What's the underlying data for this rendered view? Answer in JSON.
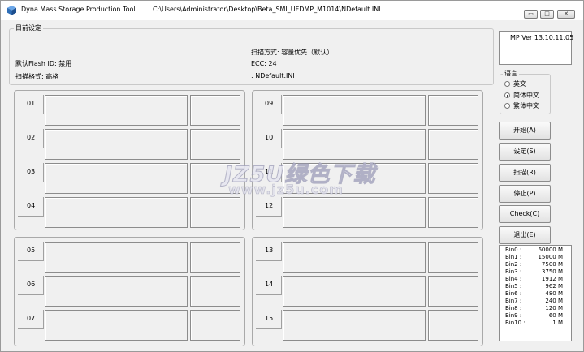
{
  "window": {
    "title": "Dyna Mass Storage Production Tool",
    "path": "C:\\Users\\Administrator\\Desktop\\Beta_SMI_UFDMP_M1014\\NDefault.INI",
    "min_glyph": "▭",
    "max_glyph": "□",
    "close_glyph": "✕"
  },
  "settings": {
    "legend": "目前设定",
    "scan_mode": "扫描方式: 容量优先（默认）",
    "flash_id": "默认Flash ID: 禁用",
    "ecc": "ECC: 24",
    "scan_format": "扫描格式: 高格",
    "ini_file": ": NDefault.INI"
  },
  "version": "MP Ver 13.10.11.05",
  "language": {
    "legend": "语言",
    "options": [
      "英文",
      "简体中文",
      "繁体中文"
    ],
    "selected": "简体中文"
  },
  "buttons": {
    "start": "开始(A)",
    "settings": "设定(S)",
    "scan": "扫描(R)",
    "stop": "停止(P)",
    "check": "Check(C)",
    "exit": "退出(E)"
  },
  "slots": [
    "01",
    "02",
    "03",
    "04",
    "05",
    "06",
    "07",
    "09",
    "10",
    "11",
    "12",
    "13",
    "14",
    "15"
  ],
  "bins": [
    {
      "name": "Bin0 :",
      "value": "60000 M"
    },
    {
      "name": "Bin1 :",
      "value": "15000 M"
    },
    {
      "name": "Bin2 :",
      "value": "7500 M"
    },
    {
      "name": "Bin3 :",
      "value": "3750 M"
    },
    {
      "name": "Bin4 :",
      "value": "1912 M"
    },
    {
      "name": "Bin5 :",
      "value": "962 M"
    },
    {
      "name": "Bin6 :",
      "value": "480 M"
    },
    {
      "name": "Bin7 :",
      "value": "240 M"
    },
    {
      "name": "Bin8 :",
      "value": "120 M"
    },
    {
      "name": "Bin9 :",
      "value": "60 M"
    },
    {
      "name": "Bin10 :",
      "value": "1 M"
    }
  ],
  "watermark": {
    "line1": "JZ5U绿色下载",
    "line2": "www.jz5u.com"
  },
  "colors": {
    "window_bg": "#f0f0f0",
    "titlebar_bg": "#ffffff",
    "icon_blue": "#2f6fb8"
  }
}
